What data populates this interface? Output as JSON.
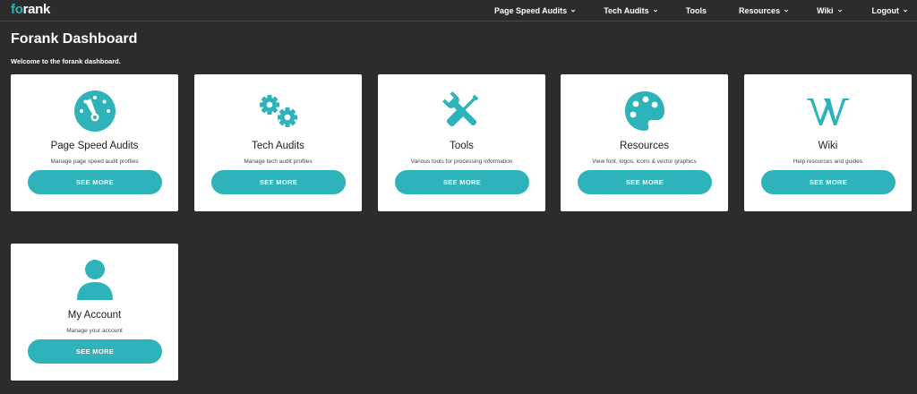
{
  "brand": {
    "prefix": "fo",
    "suffix": "rank",
    "accent_color": "#2fb3ba"
  },
  "nav": [
    {
      "label": "Page Speed Audits",
      "dropdown": true
    },
    {
      "label": "Tech Audits",
      "dropdown": true
    },
    {
      "label": "Tools",
      "dropdown": false
    },
    {
      "label": "Resources",
      "dropdown": true
    },
    {
      "label": "Wiki",
      "dropdown": true
    },
    {
      "label": "Logout",
      "dropdown": true
    }
  ],
  "header": {
    "title": "Forank Dashboard",
    "welcome": "Welcome to the forank dashboard."
  },
  "cards": [
    {
      "icon": "speedometer-icon",
      "title": "Page Speed Audits",
      "description": "Manage page speed audit profiles",
      "button": "SEE MORE"
    },
    {
      "icon": "gears-icon",
      "title": "Tech Audits",
      "description": "Manage tech audit profiles",
      "button": "SEE MORE"
    },
    {
      "icon": "tools-icon",
      "title": "Tools",
      "description": "Various tools for processing information",
      "button": "SEE MORE"
    },
    {
      "icon": "palette-icon",
      "title": "Resources",
      "description": "View font, logos, icons & vector graphics",
      "button": "SEE MORE"
    },
    {
      "icon": "wikipedia-icon",
      "title": "Wiki",
      "description": "Help resources and guides",
      "button": "SEE MORE"
    },
    {
      "icon": "user-icon",
      "title": "My Account",
      "description": "Manage your account",
      "button": "SEE MORE"
    }
  ],
  "colors": {
    "background": "#2c2c2c",
    "card": "#ffffff",
    "accent": "#2fb3ba"
  }
}
